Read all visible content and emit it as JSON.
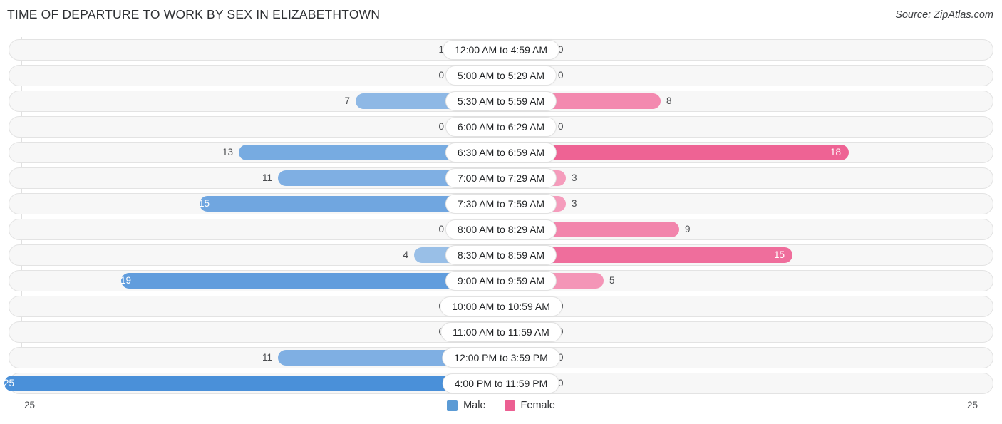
{
  "header": {
    "title": "TIME OF DEPARTURE TO WORK BY SEX IN ELIZABETHTOWN",
    "source": "Source: ZipAtlas.com"
  },
  "legend": {
    "male_label": "Male",
    "female_label": "Female",
    "male_color": "#5b9bd5",
    "female_color": "#ec5f92"
  },
  "axis": {
    "left_max": "25",
    "right_max": "25"
  },
  "chart_data": {
    "type": "bar",
    "title": "TIME OF DEPARTURE TO WORK BY SEX IN ELIZABETHTOWN",
    "xlabel": "",
    "ylabel": "",
    "orientation": "horizontal-diverging",
    "grid": true,
    "legend_position": "bottom-center",
    "xlim": [
      25,
      25
    ],
    "categories": [
      "12:00 AM to 4:59 AM",
      "5:00 AM to 5:29 AM",
      "5:30 AM to 5:59 AM",
      "6:00 AM to 6:29 AM",
      "6:30 AM to 6:59 AM",
      "7:00 AM to 7:29 AM",
      "7:30 AM to 7:59 AM",
      "8:00 AM to 8:29 AM",
      "8:30 AM to 8:59 AM",
      "9:00 AM to 9:59 AM",
      "10:00 AM to 10:59 AM",
      "11:00 AM to 11:59 AM",
      "12:00 PM to 3:59 PM",
      "4:00 PM to 11:59 PM"
    ],
    "series": [
      {
        "name": "Male",
        "values": [
          1,
          0,
          7,
          0,
          13,
          11,
          15,
          0,
          4,
          19,
          0,
          0,
          11,
          25
        ]
      },
      {
        "name": "Female",
        "values": [
          0,
          0,
          8,
          0,
          18,
          3,
          3,
          9,
          15,
          5,
          0,
          0,
          0,
          0
        ]
      }
    ]
  },
  "rows": [
    {
      "category": "12:00 AM to 4:59 AM",
      "male": "1",
      "female": "0"
    },
    {
      "category": "5:00 AM to 5:29 AM",
      "male": "0",
      "female": "0"
    },
    {
      "category": "5:30 AM to 5:59 AM",
      "male": "7",
      "female": "8"
    },
    {
      "category": "6:00 AM to 6:29 AM",
      "male": "0",
      "female": "0"
    },
    {
      "category": "6:30 AM to 6:59 AM",
      "male": "13",
      "female": "18"
    },
    {
      "category": "7:00 AM to 7:29 AM",
      "male": "11",
      "female": "3"
    },
    {
      "category": "7:30 AM to 7:59 AM",
      "male": "15",
      "female": "3"
    },
    {
      "category": "8:00 AM to 8:29 AM",
      "male": "0",
      "female": "9"
    },
    {
      "category": "8:30 AM to 8:59 AM",
      "male": "4",
      "female": "15"
    },
    {
      "category": "9:00 AM to 9:59 AM",
      "male": "19",
      "female": "5"
    },
    {
      "category": "10:00 AM to 10:59 AM",
      "male": "0",
      "female": "0"
    },
    {
      "category": "11:00 AM to 11:59 AM",
      "male": "0",
      "female": "0"
    },
    {
      "category": "12:00 PM to 3:59 PM",
      "male": "11",
      "female": "0"
    },
    {
      "category": "4:00 PM to 11:59 PM",
      "male": "25",
      "female": "0"
    }
  ]
}
